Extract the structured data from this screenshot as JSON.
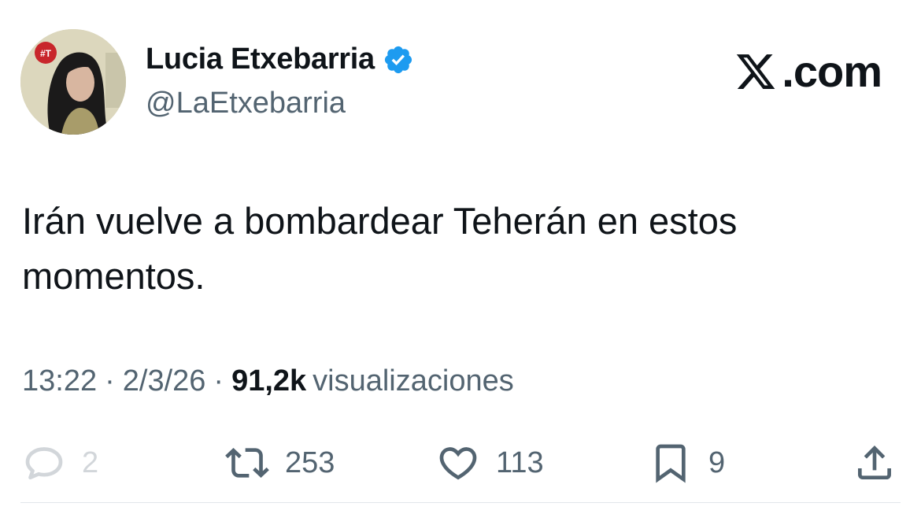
{
  "author": {
    "name": "Lucia Etxebarria",
    "handle": "@LaEtxebarria",
    "avatar_badge": "#T",
    "verified_icon": "verified-badge-icon"
  },
  "brand": {
    "label": ".com",
    "logo_icon": "x-logo-icon"
  },
  "tweet": {
    "text": "Irán vuelve a bombardear Teherán en estos momentos."
  },
  "meta": {
    "time": "13:22",
    "separator1": "·",
    "date": "2/3/26",
    "separator2": "·",
    "views": "91,2k",
    "views_label": "visualizaciones"
  },
  "actions": {
    "replies": "2",
    "retweets": "253",
    "likes": "113",
    "bookmarks": "9"
  },
  "colors": {
    "text": "#0f1419",
    "secondary": "#536471",
    "verified": "#1d9bf0",
    "disabled": "#d2d6da"
  }
}
